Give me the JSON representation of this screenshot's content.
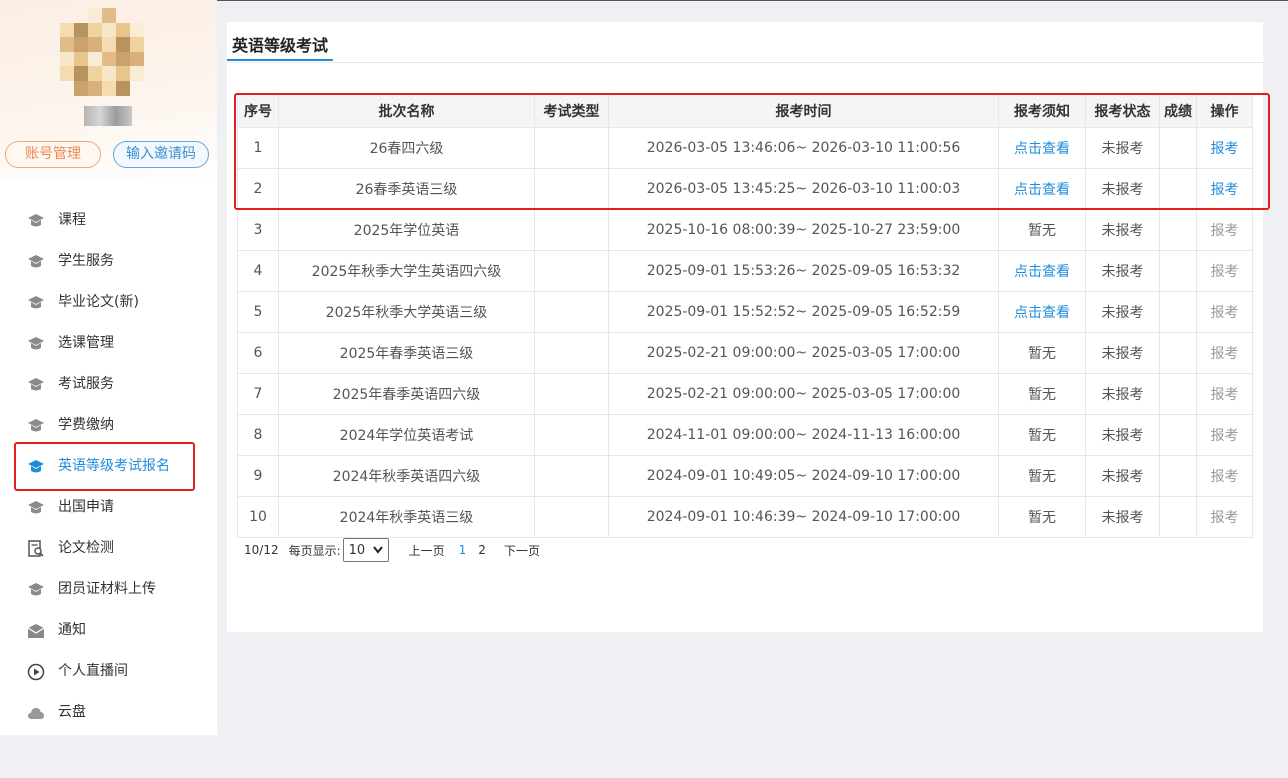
{
  "sidebar": {
    "buttons": {
      "account": "账号管理",
      "invite": "输入邀请码"
    },
    "items": [
      {
        "label": "课程",
        "icon": "cap-icon"
      },
      {
        "label": "学生服务",
        "icon": "cap-icon"
      },
      {
        "label": "毕业论文(新)",
        "icon": "cap-icon"
      },
      {
        "label": "选课管理",
        "icon": "cap-icon"
      },
      {
        "label": "考试服务",
        "icon": "cap-icon"
      },
      {
        "label": "学费缴纳",
        "icon": "cap-icon"
      },
      {
        "label": "英语等级考试报名",
        "icon": "cap-icon",
        "active": true
      },
      {
        "label": "出国申请",
        "icon": "cap-icon"
      },
      {
        "label": "论文检测",
        "icon": "doc-search-icon"
      },
      {
        "label": "团员证材料上传",
        "icon": "cap-icon"
      },
      {
        "label": "通知",
        "icon": "mail-icon"
      },
      {
        "label": "个人直播间",
        "icon": "play-icon"
      },
      {
        "label": "云盘",
        "icon": "cloud-icon"
      }
    ]
  },
  "main": {
    "title": "英语等级考试",
    "table": {
      "headers": [
        "序号",
        "批次名称",
        "考试类型",
        "报考时间",
        "报考须知",
        "报考状态",
        "成绩",
        "操作"
      ],
      "rows": [
        {
          "no": "1",
          "name": "26春四六级",
          "type": "",
          "time": "2026-03-05 13:46:06~ 2026-03-10 11:00:56",
          "notice": "点击查看",
          "notice_link": true,
          "status": "未报考",
          "score": "",
          "op": "报考",
          "op_enabled": true
        },
        {
          "no": "2",
          "name": "26春季英语三级",
          "type": "",
          "time": "2026-03-05 13:45:25~ 2026-03-10 11:00:03",
          "notice": "点击查看",
          "notice_link": true,
          "status": "未报考",
          "score": "",
          "op": "报考",
          "op_enabled": true
        },
        {
          "no": "3",
          "name": "2025年学位英语",
          "type": "",
          "time": "2025-10-16 08:00:39~ 2025-10-27 23:59:00",
          "notice": "暂无",
          "notice_link": false,
          "status": "未报考",
          "score": "",
          "op": "报考",
          "op_enabled": false
        },
        {
          "no": "4",
          "name": "2025年秋季大学生英语四六级",
          "type": "",
          "time": "2025-09-01 15:53:26~ 2025-09-05 16:53:32",
          "notice": "点击查看",
          "notice_link": true,
          "status": "未报考",
          "score": "",
          "op": "报考",
          "op_enabled": false
        },
        {
          "no": "5",
          "name": "2025年秋季大学英语三级",
          "type": "",
          "time": "2025-09-01 15:52:52~ 2025-09-05 16:52:59",
          "notice": "点击查看",
          "notice_link": true,
          "status": "未报考",
          "score": "",
          "op": "报考",
          "op_enabled": false
        },
        {
          "no": "6",
          "name": "2025年春季英语三级",
          "type": "",
          "time": "2025-02-21 09:00:00~ 2025-03-05 17:00:00",
          "notice": "暂无",
          "notice_link": false,
          "status": "未报考",
          "score": "",
          "op": "报考",
          "op_enabled": false
        },
        {
          "no": "7",
          "name": "2025年春季英语四六级",
          "type": "",
          "time": "2025-02-21 09:00:00~ 2025-03-05 17:00:00",
          "notice": "暂无",
          "notice_link": false,
          "status": "未报考",
          "score": "",
          "op": "报考",
          "op_enabled": false
        },
        {
          "no": "8",
          "name": "2024年学位英语考试",
          "type": "",
          "time": "2024-11-01 09:00:00~ 2024-11-13 16:00:00",
          "notice": "暂无",
          "notice_link": false,
          "status": "未报考",
          "score": "",
          "op": "报考",
          "op_enabled": false
        },
        {
          "no": "9",
          "name": "2024年秋季英语四六级",
          "type": "",
          "time": "2024-09-01 10:49:05~ 2024-09-10 17:00:00",
          "notice": "暂无",
          "notice_link": false,
          "status": "未报考",
          "score": "",
          "op": "报考",
          "op_enabled": false
        },
        {
          "no": "10",
          "name": "2024年秋季英语三级",
          "type": "",
          "time": "2024-09-01 10:46:39~ 2024-09-10 17:00:00",
          "notice": "暂无",
          "notice_link": false,
          "status": "未报考",
          "score": "",
          "op": "报考",
          "op_enabled": false
        }
      ]
    },
    "pager": {
      "summary": "10/12",
      "per_page_label": "每页显示:",
      "per_page_value": "10",
      "prev": "上一页",
      "pages": [
        "1",
        "2"
      ],
      "current_page": "1",
      "next": "下一页"
    }
  },
  "colors": {
    "accent": "#1f8ddc",
    "highlight": "#e02020",
    "account_button": "#ef8a4d",
    "invite_button": "#3a8fd1"
  }
}
